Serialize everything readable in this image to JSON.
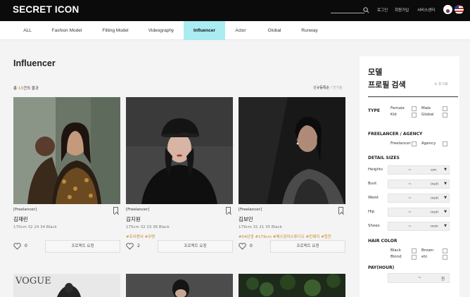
{
  "header": {
    "logo": "SECRET ICON",
    "nav": [
      "로그인",
      "회원가입",
      "서비스센터"
    ]
  },
  "menu": {
    "items": [
      "ALL",
      "Fashion Model",
      "Fitting Model",
      "Videography",
      "Influencer",
      "Actor",
      "Global",
      "Runway"
    ],
    "active": "Influencer"
  },
  "main": {
    "title": "Influencer",
    "result_prefix": "총 ",
    "result_num": "13",
    "result_suffix": "건의 결과",
    "sort_active": "신규등록순",
    "sort_sep": " / ",
    "sort_inactive": "인기순"
  },
  "cards": [
    {
      "type": "[Freelancer]",
      "name": "김재린",
      "stats": "170cm   32 24 34   Black",
      "tags": "",
      "likes": "0",
      "button": "프로젝트 요청"
    },
    {
      "type": "[Freelancer]",
      "name": "김지원",
      "stats": "175cm   32 23 36   Black",
      "tags": "#프리랜서 #무명",
      "likes": "2",
      "button": "프로젝트 요청"
    },
    {
      "type": "[Freelancer]",
      "name": "김보민",
      "stats": "179cm   31 21 35   Black",
      "tags": "#04년생 #179cm #메스킴미스튜디오 #런웨이 #합잔",
      "likes": "0",
      "button": "프로젝트 요청"
    }
  ],
  "bottom_row": {
    "vogue": "VOGUE"
  },
  "sidebar": {
    "title_line1": "모델",
    "title_line2": "프로필 검색",
    "reset": "초기화",
    "type_label": "TYPE",
    "type_options": [
      "Female",
      "Male",
      "Kid",
      "Global"
    ],
    "freelancer_label": "FREELANCER / AGENCY",
    "freelancer_options": [
      "Freelancer",
      "Agency"
    ],
    "detail_label": "DETAIL SIZES",
    "fields": [
      {
        "label": "Heights",
        "dash": "~",
        "unit": "cm"
      },
      {
        "label": "Bust",
        "dash": "~",
        "unit": "inch"
      },
      {
        "label": "Waist",
        "dash": "~",
        "unit": "inch"
      },
      {
        "label": "Hip",
        "dash": "~",
        "unit": "inch"
      },
      {
        "label": "Shoes",
        "dash": "~",
        "unit": "mm"
      }
    ],
    "hair_label": "HAIR COLOR",
    "hair_options": [
      "Black",
      "Brown",
      "Blond",
      "etc"
    ],
    "pay_label": "PAY(HOUR)",
    "pay_dash": "~",
    "pay_unit": "원"
  }
}
